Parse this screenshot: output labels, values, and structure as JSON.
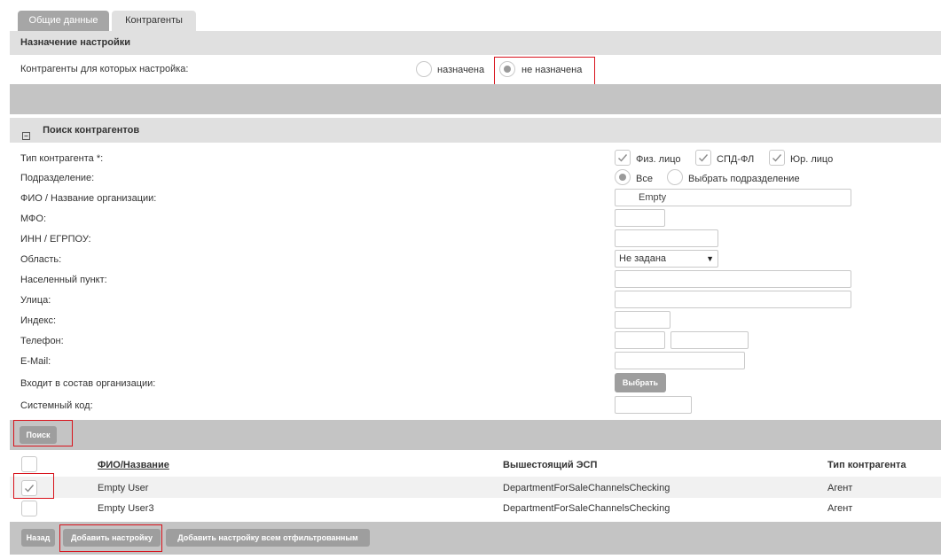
{
  "tabs": [
    {
      "label": "Общие данные",
      "active": false
    },
    {
      "label": "Контрагенты",
      "active": true
    }
  ],
  "assignment": {
    "header": "Назначение настройки",
    "question": "Контрагенты для которых настройка:",
    "options": [
      {
        "label": "назначена",
        "selected": false
      },
      {
        "label": "не назначена",
        "selected": true
      }
    ]
  },
  "search": {
    "header": "Поиск контрагентов",
    "collapse_icon": "minus-square-icon",
    "fields": {
      "type_label": "Тип контрагента *:",
      "type_options": [
        {
          "label": "Физ. лицо",
          "checked": true
        },
        {
          "label": "СПД-ФЛ",
          "checked": true
        },
        {
          "label": "Юр. лицо",
          "checked": true
        }
      ],
      "division_label": "Подразделение:",
      "division_options": [
        {
          "label": "Все",
          "selected": true
        },
        {
          "label": "Выбрать подразделение",
          "selected": false
        }
      ],
      "name_label": "ФИО / Название организации:",
      "name_value": "Empty",
      "mfo_label": "МФО:",
      "inn_label": "ИНН / ЕГРПОУ:",
      "region_label": "Область:",
      "region_value": "Не задана",
      "city_label": "Населенный пункт:",
      "street_label": "Улица:",
      "index_label": "Индекс:",
      "phone_label": "Телефон:",
      "email_label": "E-Mail:",
      "org_label": "Входит в состав организации:",
      "org_button": "Выбрать",
      "syscode_label": "Системный код:"
    },
    "search_button": "Поиск"
  },
  "table": {
    "columns": [
      "ФИО/Название",
      "Вышестоящий ЭСП",
      "Тип контрагента"
    ],
    "rows": [
      {
        "checked": true,
        "name": "Empty User",
        "parent": "DepartmentForSaleChannelsChecking",
        "type": "Агент"
      },
      {
        "checked": false,
        "name": "Empty User3",
        "parent": "DepartmentForSaleChannelsChecking",
        "type": "Агент"
      }
    ]
  },
  "footer": {
    "back_button": "Назад",
    "add_button": "Добавить настройку",
    "add_all_button": "Добавить настройку всем отфильтрованным"
  },
  "colors": {
    "highlight": "#d8121b",
    "button": "#9e9e9e",
    "band": "#c4c4c4",
    "header": "#e0e0e0"
  }
}
